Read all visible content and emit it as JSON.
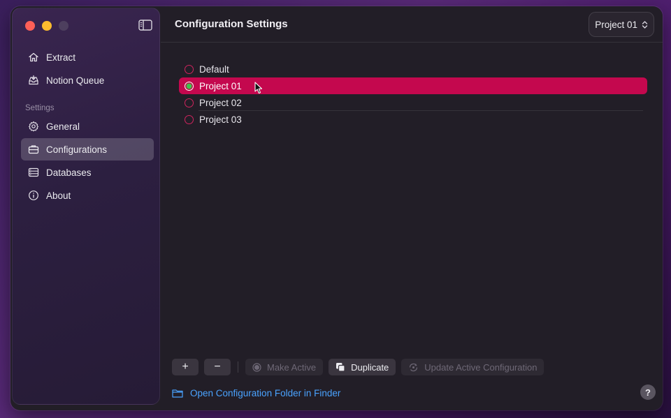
{
  "window": {
    "title": "Configuration Settings"
  },
  "sidebar": {
    "top_items": [
      {
        "label": "Extract",
        "icon": "house-icon"
      },
      {
        "label": "Notion Queue",
        "icon": "tray-icon"
      }
    ],
    "section_label": "Settings",
    "settings_items": [
      {
        "label": "General",
        "icon": "gear-icon"
      },
      {
        "label": "Configurations",
        "icon": "briefcase-icon",
        "active": true
      },
      {
        "label": "Databases",
        "icon": "database-icon"
      },
      {
        "label": "About",
        "icon": "info-icon"
      }
    ]
  },
  "header": {
    "config_picker_value": "Project 01"
  },
  "configurations": [
    {
      "name": "Default",
      "selected": false
    },
    {
      "name": "Project 01",
      "selected": true
    },
    {
      "name": "Project 02",
      "selected": false
    },
    {
      "name": "Project 03",
      "selected": false
    }
  ],
  "toolbar": {
    "add_label": "+",
    "remove_label": "−",
    "make_active_label": "Make Active",
    "duplicate_label": "Duplicate",
    "update_label": "Update Active Configuration"
  },
  "footer": {
    "open_folder_label": "Open Configuration Folder in Finder",
    "help_label": "?"
  },
  "colors": {
    "accent": "#c4084e",
    "link": "#4aa3ff",
    "active_radio": "#3ec44a"
  }
}
